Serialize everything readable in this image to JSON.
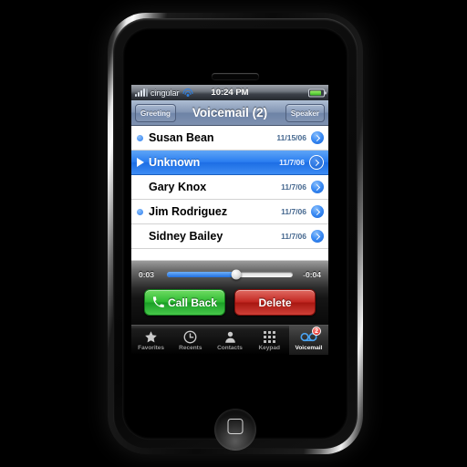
{
  "status_bar": {
    "carrier": "cingular",
    "time": "10:24 PM",
    "signal_icon": "signal-bars-icon",
    "wifi_icon": "wifi-icon",
    "battery_icon": "battery-icon"
  },
  "nav_bar": {
    "left_button": "Greeting",
    "title": "Voicemail (2)",
    "right_button": "Speaker"
  },
  "voicemails": [
    {
      "name": "Susan Bean",
      "date": "11/15/06",
      "unheard": true,
      "playing": false
    },
    {
      "name": "Unknown",
      "date": "11/7/06",
      "unheard": false,
      "playing": true
    },
    {
      "name": "Gary Knox",
      "date": "11/7/06",
      "unheard": false,
      "playing": false
    },
    {
      "name": "Jim Rodriguez",
      "date": "11/7/06",
      "unheard": true,
      "playing": false
    },
    {
      "name": "Sidney Bailey",
      "date": "11/7/06",
      "unheard": false,
      "playing": false
    }
  ],
  "player": {
    "elapsed": "0:03",
    "remaining": "-0:04",
    "progress_percent": 55
  },
  "actions": {
    "call_back": "Call Back",
    "delete": "Delete",
    "call_icon": "phone-handset-icon"
  },
  "tab_bar": {
    "tabs": [
      {
        "label": "Favorites",
        "icon": "star-icon",
        "active": false
      },
      {
        "label": "Recents",
        "icon": "clock-icon",
        "active": false
      },
      {
        "label": "Contacts",
        "icon": "person-icon",
        "active": false
      },
      {
        "label": "Keypad",
        "icon": "keypad-icon",
        "active": false
      },
      {
        "label": "Voicemail",
        "icon": "cassette-tape-icon",
        "active": true,
        "badge": "2"
      }
    ]
  },
  "colors": {
    "selection_blue": "#2a7df0",
    "call_green": "#2fbb33",
    "delete_red": "#c32822",
    "badge_red": "#d61f1f",
    "date_blue": "#46688f"
  }
}
